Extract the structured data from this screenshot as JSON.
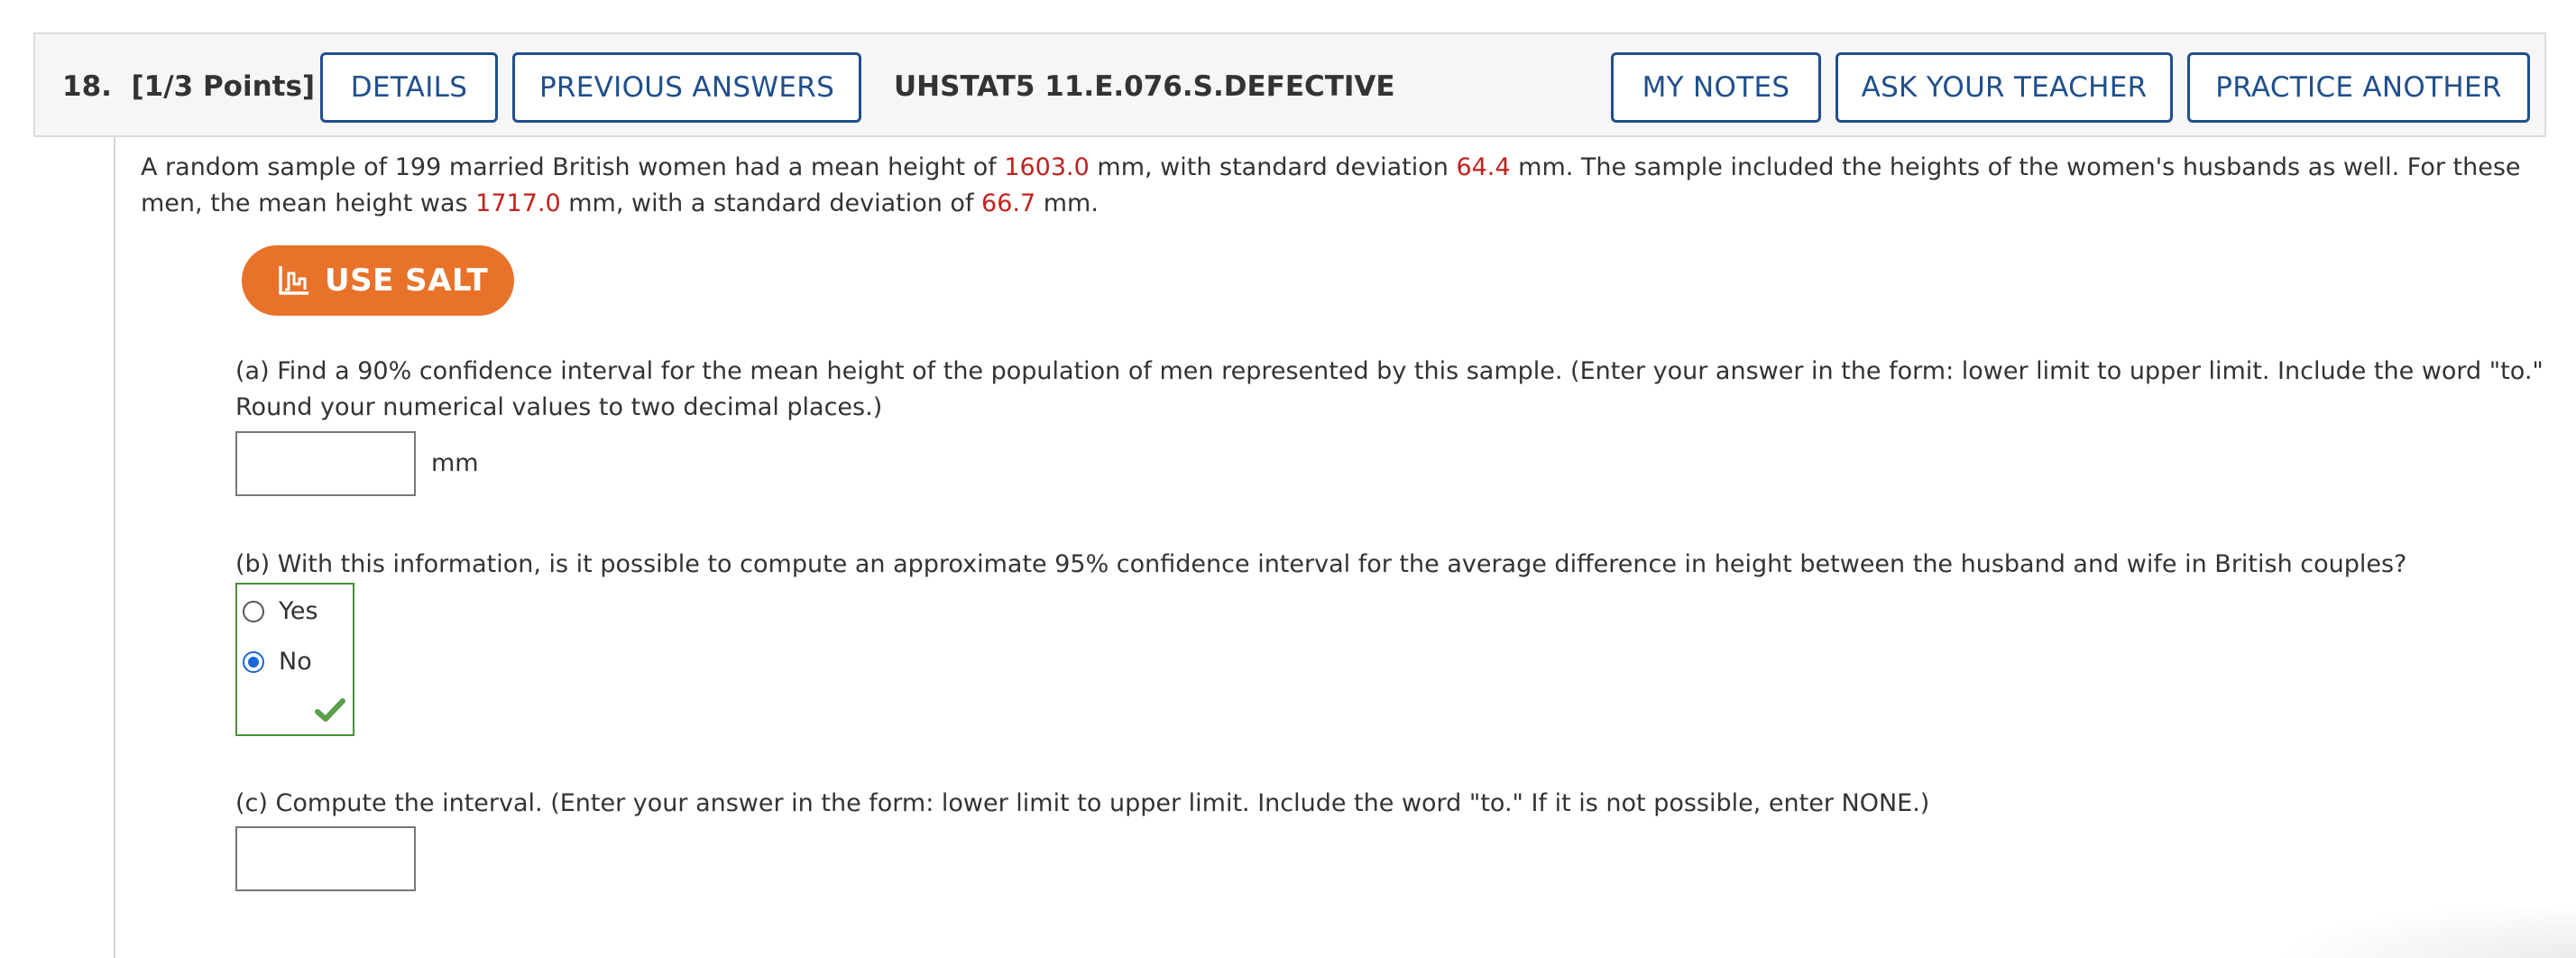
{
  "header": {
    "question_number": "18.",
    "points": "[1/3 Points]",
    "details_label": "DETAILS",
    "previous_answers_label": "PREVIOUS ANSWERS",
    "question_code": "UHSTAT5 11.E.076.S.DEFECTIVE",
    "my_notes_label": "MY NOTES",
    "ask_teacher_label": "ASK YOUR TEACHER",
    "practice_another_label": "PRACTICE ANOTHER"
  },
  "problem": {
    "intro_1": "A random sample of 199 married British women had a mean height of ",
    "women_mean": "1603.0",
    "intro_2": " mm, with standard deviation ",
    "women_sd": "64.4",
    "intro_3": " mm. The sample included the heights of the women's husbands as well. For these men, the mean height was ",
    "men_mean": "1717.0",
    "intro_4": " mm, with a standard deviation of ",
    "men_sd": "66.7",
    "intro_5": " mm."
  },
  "salt_button": {
    "label": "USE SALT",
    "icon": "salt-chart-icon"
  },
  "part_a": {
    "text": "(a) Find a 90% confidence interval for the mean height of the population of men represented by this sample. (Enter your answer in the form: lower limit to upper limit. Include the word \"to.\" Round your numerical values to two decimal places.)",
    "value": "",
    "unit": "mm"
  },
  "part_b": {
    "text": "(b) With this information, is it possible to compute an approximate 95% confidence interval for the average difference in height between the husband and wife in British couples?",
    "options": [
      {
        "label": "Yes",
        "selected": false
      },
      {
        "label": "No",
        "selected": true
      }
    ],
    "status_icon": "checkmark-icon"
  },
  "part_c": {
    "text": "(c) Compute the interval. (Enter your answer in the form: lower limit to upper limit. Include the word \"to.\" If it is not possible, enter NONE.)",
    "value": ""
  },
  "colors": {
    "button_border": "#1f4f8c",
    "value_red": "#c0221e",
    "salt_orange": "#e8722a",
    "correct_green": "#4a8f3a",
    "radio_blue": "#1a66d2"
  }
}
